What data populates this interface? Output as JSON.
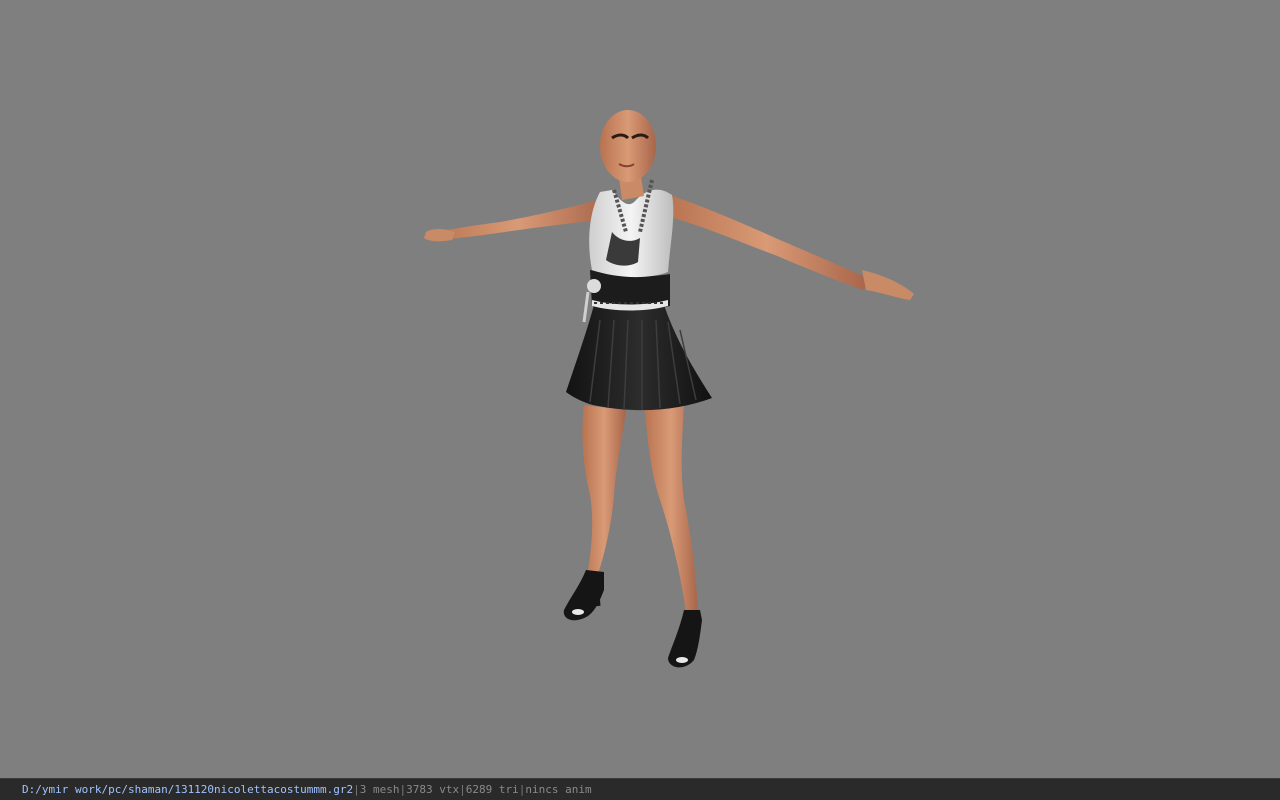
{
  "viewport": {
    "background": "#7f7f7f",
    "model": "character-t-pose"
  },
  "status_bar": {
    "file_path": "D:/ymir work/pc/shaman/131120nicolettacostummm.gr2",
    "separator": "|",
    "mesh_count": "3 mesh",
    "vertex_count": "3783 vtx",
    "triangle_count": "6289 tri",
    "animation": "nincs anim"
  },
  "colors": {
    "status_bar_bg": "#2a2a2a",
    "path_text": "#9fc3ff",
    "stat_text": "#8a8a8a"
  }
}
